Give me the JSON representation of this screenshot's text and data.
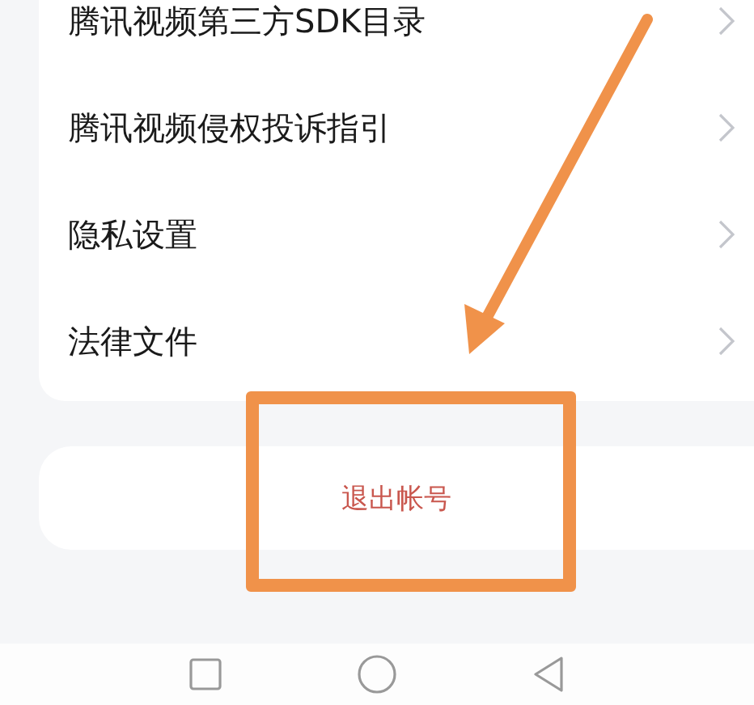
{
  "settings_list": [
    {
      "label": "腾讯视频第三方SDK目录"
    },
    {
      "label": "腾讯视频侵权投诉指引"
    },
    {
      "label": "隐私设置"
    },
    {
      "label": "法律文件"
    }
  ],
  "logout_button": {
    "label": "退出帐号"
  }
}
